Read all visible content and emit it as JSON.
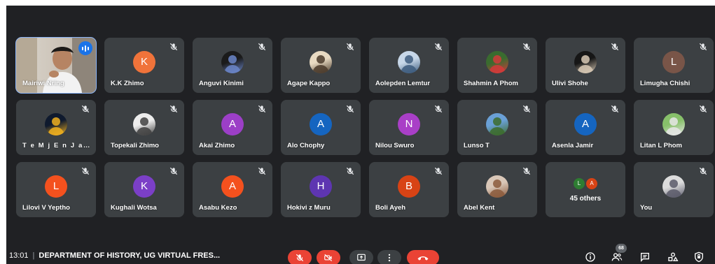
{
  "tiles": [
    {
      "name": "Mairiwi Nring",
      "type": "video",
      "speaking": true
    },
    {
      "name": "K.K Zhimo",
      "type": "letter",
      "letter": "K",
      "color": "#f0733a"
    },
    {
      "name": "Anguvi Kinimi",
      "type": "photo",
      "colors": [
        "#1b1b1b",
        "#6b86c9"
      ]
    },
    {
      "name": "Agape Kappo",
      "type": "photo",
      "colors": [
        "#e8dac2",
        "#4a3a2a"
      ]
    },
    {
      "name": "Aolepden Lemtur",
      "type": "photo",
      "colors": [
        "#c7d7e8",
        "#3d5c7e"
      ]
    },
    {
      "name": "Shahmin A Phom",
      "type": "photo",
      "colors": [
        "#3a6b2f",
        "#d43a3a"
      ]
    },
    {
      "name": "Ulivi Shohe",
      "type": "photo",
      "colors": [
        "#161616",
        "#d8c9b5"
      ]
    },
    {
      "name": "Limugha Chishi",
      "type": "letter",
      "letter": "L",
      "color": "#795548"
    },
    {
      "name": "T e M j E n J a M i R",
      "type": "photo",
      "colors": [
        "#0f1a2e",
        "#f0b020"
      ]
    },
    {
      "name": "Topekali Zhimo",
      "type": "photo",
      "colors": [
        "#ededed",
        "#404040"
      ]
    },
    {
      "name": "Akai Zhimo",
      "type": "letter",
      "letter": "A",
      "color": "#9c3fc7"
    },
    {
      "name": "Alo Chophy",
      "type": "letter",
      "letter": "A",
      "color": "#1565c0"
    },
    {
      "name": "Nilou Swuro",
      "type": "letter",
      "letter": "N",
      "color": "#a93fc7"
    },
    {
      "name": "Lunso T",
      "type": "photo",
      "colors": [
        "#6aa0d6",
        "#3c6b2b"
      ]
    },
    {
      "name": "Asenla Jamir",
      "type": "letter",
      "letter": "A",
      "color": "#1565c0"
    },
    {
      "name": "Litan L Phom",
      "type": "photo",
      "colors": [
        "#87c06a",
        "#e6e6e6"
      ]
    },
    {
      "name": "Lilovi V Yeptho",
      "type": "letter",
      "letter": "L",
      "color": "#f4511e"
    },
    {
      "name": "Kughali Wotsa",
      "type": "letter",
      "letter": "K",
      "color": "#7b3fc7"
    },
    {
      "name": "Asabu Kezo",
      "type": "letter",
      "letter": "A",
      "color": "#f4511e"
    },
    {
      "name": "Hokivi z Muru",
      "type": "letter",
      "letter": "H",
      "color": "#5e35b1"
    },
    {
      "name": "Boli Ayeh",
      "type": "letter",
      "letter": "B",
      "color": "#d84315"
    },
    {
      "name": "Abel Kent",
      "type": "photo",
      "colors": [
        "#d9c7b8",
        "#8b5a3c"
      ]
    },
    {
      "type": "others",
      "mini": [
        {
          "letter": "L",
          "color": "#2e7d32"
        },
        {
          "letter": "A",
          "color": "#d84315"
        }
      ],
      "label": "45 others"
    },
    {
      "name": "You",
      "type": "photo",
      "colors": [
        "#dcdcdc",
        "#5a5a6a"
      ]
    }
  ],
  "bottom": {
    "time": "13:01",
    "separator": "|",
    "meeting_title": "DEPARTMENT OF HISTORY, UG VIRTUAL FRES...",
    "participant_count": "68"
  },
  "icons": {
    "mute": "mic-off-icon",
    "speaking": "audio-level-icon",
    "mic": "mic-off-icon",
    "camera": "videocam-off-icon",
    "present": "present-screen-icon",
    "more": "more-vert-icon",
    "leave": "call-end-icon",
    "info": "info-icon",
    "people": "people-icon",
    "chat": "chat-icon",
    "activities": "activities-icon",
    "host": "host-controls-icon"
  },
  "colors": {
    "background": "#202124",
    "tile": "#3c4043",
    "danger": "#ea4335",
    "control": "#3c4043",
    "speaking_border": "#8ab4f8"
  }
}
